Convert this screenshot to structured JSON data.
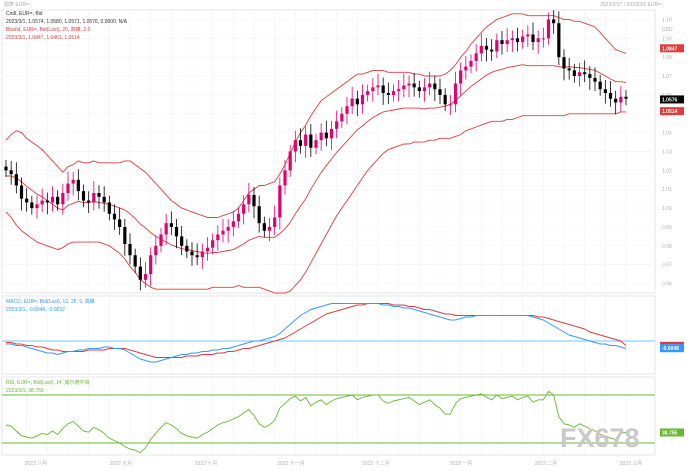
{
  "header": {
    "top_left": "图表 EUR=",
    "top_right": "2023/2/17 - 2023/3/3 EUR="
  },
  "panels": {
    "price": {
      "line1": "Cndl, EUR=, Bid",
      "line1_values": "2023/3/1, 1.0574, 1.0580, 1.0571, 1.0576, 0.0000, N/A",
      "line2": "Bband, EUR=, Bid(Last), 20, 高峰, 2.0",
      "line2_values": "2023/3/1, 1.0847, 1.0461, 1.0514",
      "unit": "USD",
      "price_tags": [
        "1.0847",
        "1.0576",
        "1.0514"
      ]
    },
    "macd": {
      "line1": "MACD, EUR=, Bid(Last), 12, 26, 9, 高峰",
      "line1_values": "2023/3/1, -0.0048, -0.0032",
      "tags": [
        "-0.0032",
        "-0.0048"
      ]
    },
    "rsi": {
      "line1": "RSI, EUR=, Bid(Last), 14, 威尔德平滑",
      "line1_values": "2023/3/1, 38.755",
      "tag": "38.755"
    }
  },
  "watermark": "FX678",
  "colors": {
    "bull_candle": "#e0006e",
    "bear_candle": "#000000",
    "bollinger": "#e03c3c",
    "macd_line": "#3399ff",
    "signal_line": "#e03c3c",
    "zero_line": "#66ccff",
    "rsi_line": "#66b832",
    "rsi_bands": "#66b832",
    "last_price_tag": "#000000"
  },
  "chart_data": [
    {
      "type": "line",
      "title": "Cndl, EUR=, Bid",
      "note": "EUR/USD daily candlesticks with Bollinger Bands (20, 2.0)",
      "ylim": [
        0.955,
        1.105
      ],
      "yticks": [
        0.96,
        0.97,
        0.98,
        0.99,
        1.0,
        1.01,
        1.02,
        1.03,
        1.04,
        1.05,
        1.06,
        1.07,
        1.08,
        1.09,
        1.1
      ],
      "xticks": [
        "2022 八月",
        "2022 九月",
        "2022 十月",
        "2022 十一月",
        "2022 十二月",
        "2023 一月",
        "2023 二月",
        "2023 三月"
      ],
      "series": [
        {
          "name": "Close",
          "values": [
            1.02,
            1.018,
            1.012,
            1.005,
            1.003,
            1.0,
            1.002,
            1.004,
            1.003,
            1.006,
            1.002,
            1.008,
            1.013,
            1.015,
            1.009,
            1.004,
            1.003,
            1.008,
            1.006,
            1.003,
            0.997,
            0.994,
            0.99,
            0.981,
            0.975,
            0.969,
            0.962,
            0.965,
            0.975,
            0.98,
            0.986,
            0.992,
            0.99,
            0.985,
            0.98,
            0.977,
            0.975,
            0.974,
            0.977,
            0.979,
            0.983,
            0.986,
            0.988,
            0.99,
            0.993,
            0.997,
            1.002,
            1.007,
            1.001,
            0.992,
            0.988,
            0.99,
            0.995,
            1.012,
            1.02,
            1.03,
            1.036,
            1.033,
            1.039,
            1.032,
            1.036,
            1.04,
            1.037,
            1.042,
            1.046,
            1.05,
            1.054,
            1.058,
            1.055,
            1.06,
            1.062,
            1.064,
            1.065,
            1.061,
            1.06,
            1.062,
            1.063,
            1.065,
            1.066,
            1.064,
            1.062,
            1.064,
            1.066,
            1.063,
            1.06,
            1.055,
            1.055,
            1.066,
            1.073,
            1.075,
            1.078,
            1.082,
            1.086,
            1.084,
            1.083,
            1.089,
            1.087,
            1.089,
            1.09,
            1.088,
            1.091,
            1.092,
            1.088,
            1.09,
            1.09,
            1.1,
            1.098,
            1.08,
            1.074,
            1.073,
            1.07,
            1.072,
            1.071,
            1.069,
            1.067,
            1.063,
            1.061,
            1.058,
            1.056,
            1.059,
            1.058
          ]
        },
        {
          "name": "BB Upper",
          "values": [
            1.036,
            1.039,
            1.041,
            1.04,
            1.037,
            1.035,
            1.033,
            1.031,
            1.028,
            1.025,
            1.022,
            1.019,
            1.022,
            1.023,
            1.025,
            1.024,
            1.024,
            1.025,
            1.024,
            1.024,
            1.024,
            1.024,
            1.024,
            1.025,
            1.025,
            1.023,
            1.021,
            1.019,
            1.016,
            1.013,
            1.01,
            1.007,
            1.004,
            1.002,
            1.0,
            0.999,
            0.998,
            0.997,
            0.996,
            0.995,
            0.995,
            0.995,
            0.996,
            0.997,
            0.998,
            1.0,
            1.004,
            1.008,
            1.01,
            1.012,
            1.012,
            1.013,
            1.014,
            1.018,
            1.023,
            1.029,
            1.035,
            1.04,
            1.044,
            1.049,
            1.053,
            1.057,
            1.059,
            1.061,
            1.063,
            1.065,
            1.067,
            1.069,
            1.071,
            1.071,
            1.072,
            1.073,
            1.073,
            1.073,
            1.072,
            1.072,
            1.072,
            1.072,
            1.072,
            1.071,
            1.071,
            1.07,
            1.07,
            1.07,
            1.07,
            1.071,
            1.073,
            1.076,
            1.08,
            1.083,
            1.087,
            1.09,
            1.093,
            1.096,
            1.098,
            1.1,
            1.101,
            1.102,
            1.103,
            1.103,
            1.103,
            1.102,
            1.102,
            1.102,
            1.102,
            1.102,
            1.102,
            1.101,
            1.1,
            1.1,
            1.099,
            1.099,
            1.098,
            1.097,
            1.096,
            1.093,
            1.09,
            1.087,
            1.084,
            1.083,
            1.082
          ]
        },
        {
          "name": "BB Lower",
          "values": [
            0.998,
            0.995,
            0.991,
            0.988,
            0.986,
            0.984,
            0.982,
            0.981,
            0.98,
            0.979,
            0.978,
            0.979,
            0.981,
            0.982,
            0.982,
            0.982,
            0.982,
            0.982,
            0.982,
            0.981,
            0.98,
            0.978,
            0.976,
            0.973,
            0.969,
            0.966,
            0.962,
            0.96,
            0.958,
            0.957,
            0.957,
            0.957,
            0.957,
            0.957,
            0.957,
            0.957,
            0.957,
            0.957,
            0.957,
            0.957,
            0.958,
            0.958,
            0.958,
            0.958,
            0.958,
            0.959,
            0.958,
            0.958,
            0.958,
            0.958,
            0.957,
            0.956,
            0.955,
            0.955,
            0.955,
            0.956,
            0.959,
            0.962,
            0.966,
            0.971,
            0.976,
            0.981,
            0.986,
            0.991,
            0.996,
            1.0,
            1.004,
            1.008,
            1.012,
            1.016,
            1.02,
            1.023,
            1.026,
            1.029,
            1.031,
            1.032,
            1.033,
            1.034,
            1.034,
            1.035,
            1.035,
            1.035,
            1.036,
            1.036,
            1.037,
            1.037,
            1.037,
            1.038,
            1.039,
            1.041,
            1.042,
            1.043,
            1.044,
            1.045,
            1.046,
            1.046,
            1.046,
            1.047,
            1.047,
            1.048,
            1.049,
            1.049,
            1.049,
            1.049,
            1.049,
            1.049,
            1.049,
            1.049,
            1.049,
            1.05,
            1.05,
            1.05,
            1.05,
            1.05,
            1.05,
            1.05,
            1.05,
            1.05,
            1.05,
            1.051,
            1.051
          ]
        }
      ]
    },
    {
      "type": "line",
      "title": "MACD, EUR=, Bid(Last), 12, 26, 9",
      "ylim": [
        -0.022,
        0.03
      ],
      "series": [
        {
          "name": "MACD",
          "values": [
            -0.002,
            -0.002,
            -0.003,
            -0.003,
            -0.004,
            -0.005,
            -0.006,
            -0.007,
            -0.008,
            -0.008,
            -0.009,
            -0.008,
            -0.007,
            -0.007,
            -0.006,
            -0.006,
            -0.005,
            -0.005,
            -0.005,
            -0.004,
            -0.004,
            -0.005,
            -0.005,
            -0.006,
            -0.008,
            -0.01,
            -0.012,
            -0.013,
            -0.014,
            -0.014,
            -0.013,
            -0.012,
            -0.011,
            -0.01,
            -0.009,
            -0.009,
            -0.008,
            -0.008,
            -0.007,
            -0.007,
            -0.006,
            -0.006,
            -0.005,
            -0.005,
            -0.004,
            -0.003,
            -0.002,
            -0.001,
            0.0,
            0.0,
            0.001,
            0.002,
            0.003,
            0.005,
            0.008,
            0.011,
            0.014,
            0.017,
            0.019,
            0.021,
            0.022,
            0.023,
            0.024,
            0.025,
            0.025,
            0.025,
            0.025,
            0.025,
            0.025,
            0.025,
            0.025,
            0.025,
            0.025,
            0.024,
            0.024,
            0.023,
            0.023,
            0.022,
            0.022,
            0.021,
            0.02,
            0.019,
            0.018,
            0.017,
            0.016,
            0.015,
            0.014,
            0.014,
            0.015,
            0.016,
            0.016,
            0.017,
            0.017,
            0.017,
            0.017,
            0.017,
            0.017,
            0.017,
            0.017,
            0.017,
            0.017,
            0.017,
            0.016,
            0.015,
            0.014,
            0.012,
            0.01,
            0.008,
            0.006,
            0.004,
            0.003,
            0.002,
            0.001,
            0.0,
            -0.001,
            -0.002,
            -0.002,
            -0.003,
            -0.003,
            -0.004,
            -0.005
          ]
        },
        {
          "name": "Signal",
          "values": [
            -0.001,
            -0.001,
            -0.002,
            -0.002,
            -0.003,
            -0.003,
            -0.004,
            -0.004,
            -0.005,
            -0.006,
            -0.006,
            -0.007,
            -0.007,
            -0.007,
            -0.007,
            -0.007,
            -0.006,
            -0.006,
            -0.006,
            -0.006,
            -0.005,
            -0.005,
            -0.005,
            -0.005,
            -0.006,
            -0.007,
            -0.008,
            -0.009,
            -0.01,
            -0.011,
            -0.011,
            -0.011,
            -0.011,
            -0.011,
            -0.011,
            -0.01,
            -0.01,
            -0.01,
            -0.009,
            -0.009,
            -0.009,
            -0.008,
            -0.008,
            -0.007,
            -0.007,
            -0.006,
            -0.005,
            -0.005,
            -0.004,
            -0.003,
            -0.002,
            -0.001,
            0.0,
            0.001,
            0.002,
            0.004,
            0.006,
            0.008,
            0.01,
            0.012,
            0.014,
            0.016,
            0.018,
            0.019,
            0.02,
            0.021,
            0.022,
            0.023,
            0.024,
            0.024,
            0.025,
            0.025,
            0.025,
            0.025,
            0.025,
            0.024,
            0.024,
            0.024,
            0.023,
            0.023,
            0.022,
            0.021,
            0.021,
            0.02,
            0.019,
            0.018,
            0.018,
            0.017,
            0.017,
            0.017,
            0.017,
            0.017,
            0.017,
            0.017,
            0.017,
            0.017,
            0.017,
            0.017,
            0.017,
            0.017,
            0.017,
            0.017,
            0.017,
            0.016,
            0.016,
            0.015,
            0.014,
            0.013,
            0.012,
            0.011,
            0.01,
            0.009,
            0.008,
            0.006,
            0.005,
            0.004,
            0.003,
            0.002,
            0.001,
            0.0,
            -0.003
          ]
        }
      ]
    },
    {
      "type": "line",
      "title": "RSI, EUR=, Bid(Last), 14",
      "ylim": [
        20,
        85
      ],
      "bands": [
        70,
        30
      ],
      "series": [
        {
          "name": "RSI",
          "values": [
            45,
            44,
            40,
            36,
            35,
            34,
            36,
            38,
            37,
            40,
            37,
            42,
            46,
            48,
            44,
            40,
            39,
            43,
            41,
            38,
            34,
            32,
            30,
            27,
            25,
            24,
            22,
            26,
            33,
            38,
            43,
            47,
            45,
            42,
            38,
            36,
            35,
            34,
            37,
            39,
            42,
            45,
            47,
            48,
            50,
            52,
            55,
            58,
            53,
            46,
            43,
            45,
            49,
            59,
            63,
            67,
            69,
            65,
            68,
            61,
            64,
            66,
            62,
            65,
            67,
            68,
            69,
            70,
            66,
            68,
            69,
            70,
            70,
            65,
            63,
            65,
            66,
            67,
            68,
            65,
            62,
            64,
            66,
            62,
            59,
            54,
            54,
            63,
            67,
            68,
            69,
            70,
            71,
            68,
            66,
            70,
            67,
            68,
            69,
            66,
            68,
            69,
            64,
            66,
            66,
            73,
            70,
            52,
            46,
            45,
            43,
            46,
            44,
            42,
            40,
            37,
            36,
            34,
            33,
            38,
            39
          ]
        }
      ]
    }
  ]
}
